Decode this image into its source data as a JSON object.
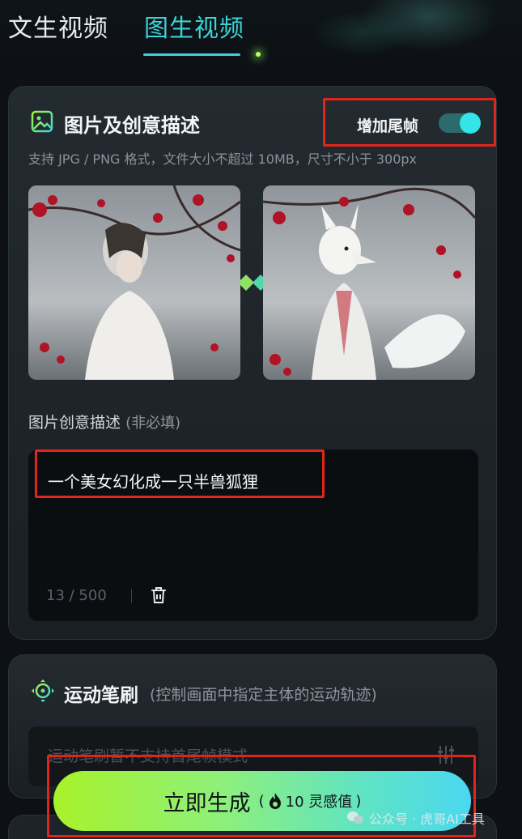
{
  "tabs": [
    {
      "label": "文生视频",
      "active": false
    },
    {
      "label": "图生视频",
      "active": true
    }
  ],
  "upload_section": {
    "title": "图片及创意描述",
    "end_frame_label": "增加尾帧",
    "end_frame_enabled": true,
    "hint": "支持 JPG / PNG 格式，文件大小不超过 10MB，尺寸不小于 300px",
    "images": [
      {
        "name": "first-frame-image"
      },
      {
        "name": "last-frame-image"
      }
    ]
  },
  "description": {
    "label": "图片创意描述",
    "optional": "(非必填)",
    "value": "一个美女幻化成一只半兽狐狸",
    "counter": "13 / 500"
  },
  "motion_brush": {
    "title": "运动笔刷",
    "subtitle": "(控制画面中指定主体的运动轨迹)",
    "note": "运动笔刷暂不支持首尾帧模式"
  },
  "generate": {
    "label": "立即生成",
    "cost_prefix": "(",
    "cost": "10 灵感值",
    "cost_suffix": ")"
  },
  "watermark": {
    "text": "公众号 · 虎哥AI工具"
  },
  "colors": {
    "accent": "#39d4d6",
    "highlight_border": "#e0261c",
    "button_gradient_start": "#a8f22a",
    "button_gradient_end": "#4ad8f0"
  }
}
